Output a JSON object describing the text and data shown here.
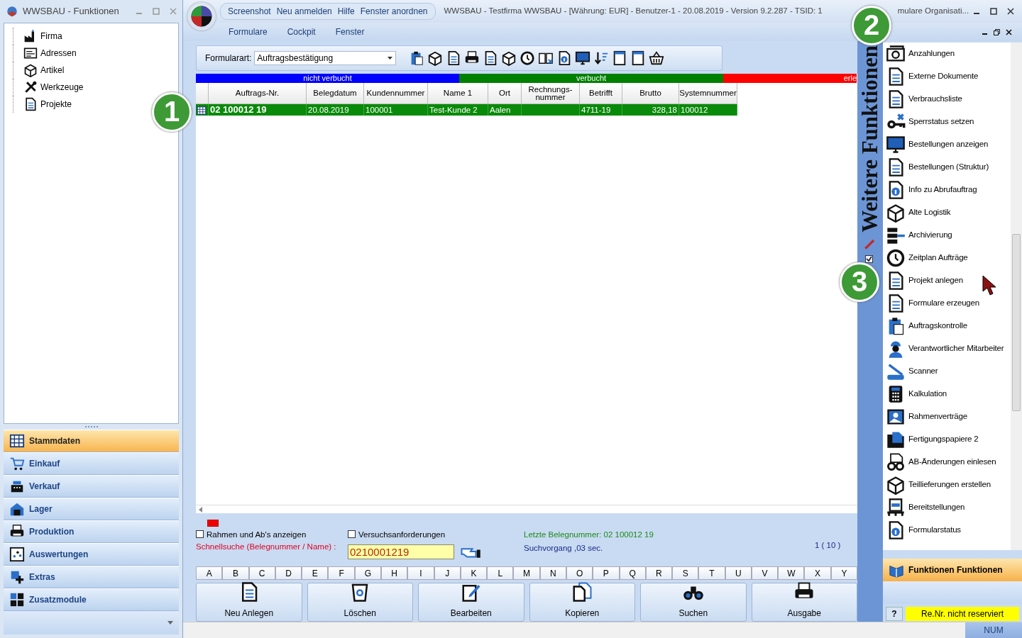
{
  "left_window": {
    "title": "WWSBAU - Funktionen",
    "tree": [
      {
        "label": "Firma"
      },
      {
        "label": "Adressen"
      },
      {
        "label": "Artikel"
      },
      {
        "label": "Werkzeuge"
      },
      {
        "label": "Projekte"
      }
    ],
    "nav": [
      {
        "label": "Stammdaten",
        "selected": true
      },
      {
        "label": "Einkauf",
        "selected": false
      },
      {
        "label": "Verkauf",
        "selected": false
      },
      {
        "label": "Lager",
        "selected": false
      },
      {
        "label": "Produktion",
        "selected": false
      },
      {
        "label": "Auswertungen",
        "selected": false
      },
      {
        "label": "Extras",
        "selected": false
      },
      {
        "label": "Zusatzmodule",
        "selected": false
      }
    ]
  },
  "main_window": {
    "quick_access": [
      "Screenshot",
      "Neu anmelden",
      "Hilfe",
      "Fenster anordnen"
    ],
    "title": "WWSBAU - Testfirma WWSBAU - [Währung: EUR] - Benutzer-1 - 20.08.2019 - Version 9.2.287 - TSID: 1",
    "title_rest": "mulare Organisati...",
    "menu": [
      "Formulare",
      "Cockpit",
      "Fenster"
    ]
  },
  "form": {
    "label": "Formularart:",
    "value": "Auftragsbestätigung"
  },
  "bands": [
    {
      "label": "nicht verbucht",
      "color": "#0000ff"
    },
    {
      "label": "verbucht",
      "color": "#008000"
    },
    {
      "label": "erle",
      "color": "#ff0000"
    }
  ],
  "table": {
    "columns": [
      "Auftrags-Nr.",
      "Belegdatum",
      "Kundennummer",
      "Name 1",
      "Ort",
      "Rechnungs-nummer",
      "Betrifft",
      "Brutto",
      "Systemnummer"
    ],
    "rows": [
      {
        "selected": true,
        "cells": [
          "02 100012 19",
          "20.08.2019",
          "100001",
          "Test-Kunde 2",
          "Aalen",
          "",
          "4711-19",
          "328,18",
          "100012"
        ]
      }
    ]
  },
  "options": [
    {
      "label": "Rahmen und Ab's anzeigen",
      "checked": false
    },
    {
      "label": "Versuchsanforderungen",
      "checked": false
    }
  ],
  "quick_search": {
    "label": "Schnellsuche (Belegnummer / Name) :",
    "value": "0210001219"
  },
  "last_number": "Letzte Belegnummer: 02 100012 19",
  "search_time": "Suchvorgang ,03 sec.",
  "count": "1 ( 10 )",
  "letters": [
    "A",
    "B",
    "C",
    "D",
    "E",
    "F",
    "G",
    "H",
    "I",
    "J",
    "K",
    "L",
    "M",
    "N",
    "O",
    "P",
    "Q",
    "R",
    "S",
    "T",
    "U",
    "V",
    "W",
    "X",
    "Y"
  ],
  "actions": [
    "Neu Anlegen",
    "Löschen",
    "Bearbeiten",
    "Kopieren",
    "Suchen",
    "Ausgabe"
  ],
  "side_title": "Weitere Funktionen",
  "side_checkbox": {
    "checked": true
  },
  "functions": [
    "Anzahlungen",
    "Externe Dokumente",
    "Verbrauchsliste",
    "Sperrstatus setzen",
    "Bestellungen anzeigen",
    "Bestellungen (Struktur)",
    "Info zu Abrufauftrag",
    "Alte Logistik",
    "Archivierung",
    "Zeitplan Aufträge",
    "Projekt anlegen",
    "Formulare erzeugen",
    "Auftragskontrolle",
    "Verantwortlicher Mitarbeiter",
    "Scanner",
    "Kalkulation",
    "Rahmenverträge",
    "Fertigungspapiere 2",
    "AB-Änderungen einlesen",
    "Teillieferungen erstellen",
    "Bereitstellungen",
    "Formularstatus"
  ],
  "functions_header": "Funktionen Funktionen",
  "help": "?",
  "reservation": "Re.Nr. nicht reserviert",
  "status": "NUM",
  "callouts": [
    "1",
    "2",
    "3"
  ]
}
